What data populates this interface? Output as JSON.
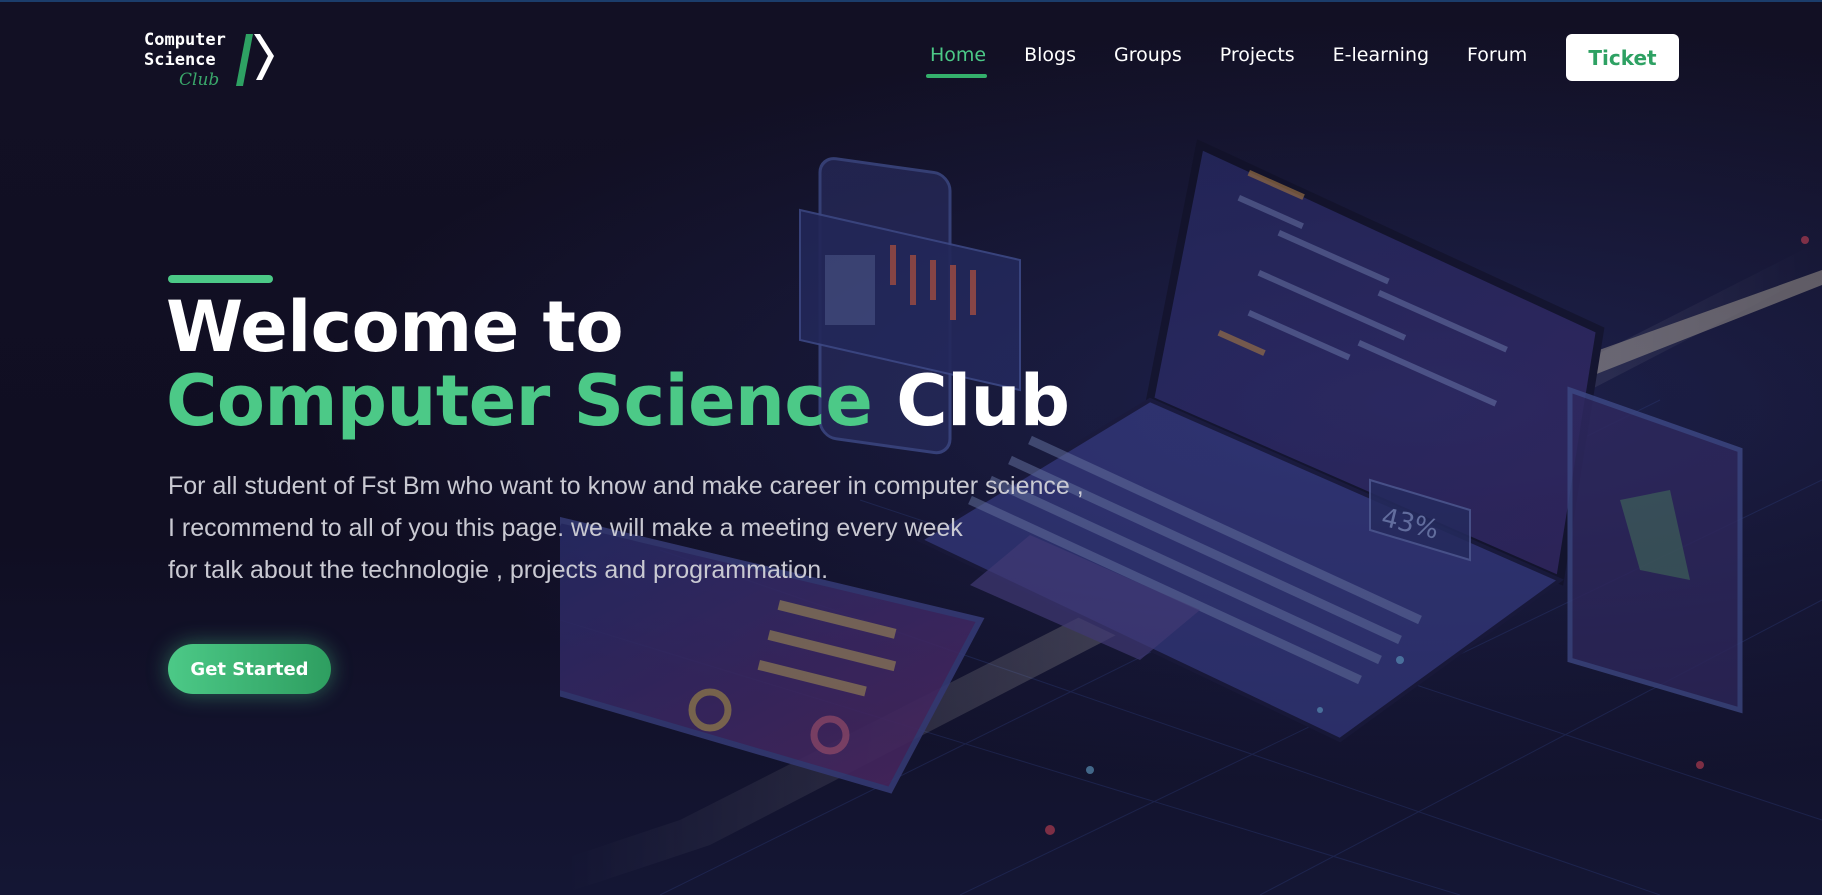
{
  "logo": {
    "line1": "Computer",
    "line2": "Science",
    "line3": "Club"
  },
  "nav": {
    "items": [
      {
        "label": "Home",
        "active": true
      },
      {
        "label": "Blogs",
        "active": false
      },
      {
        "label": "Groups",
        "active": false
      },
      {
        "label": "Projects",
        "active": false
      },
      {
        "label": "E-learning",
        "active": false
      },
      {
        "label": "Forum",
        "active": false
      }
    ],
    "ticket_label": "Ticket"
  },
  "hero": {
    "title_line1": "Welcome to",
    "title_green": "Computer Science",
    "title_white": "Club",
    "description": [
      "For all student of Fst Bm who want to know and make career in computer science ,",
      "I recommend to all of you this page. we will make a meeting every week",
      "for talk about the technologie , projects and programmation."
    ],
    "cta_label": "Get Started",
    "artwork_label": "43%"
  },
  "colors": {
    "accent_green": "#4cc987",
    "button_green": "#2ea163",
    "background": "#100e22",
    "nav_text": "#ffffff",
    "description_text": "#c9c9d2"
  }
}
